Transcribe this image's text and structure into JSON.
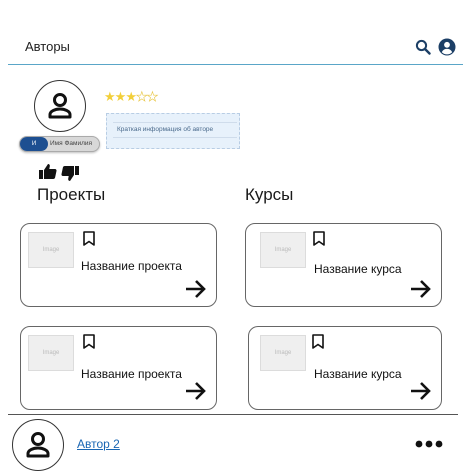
{
  "header": {
    "title": "Авторы",
    "search_icon": "search-icon",
    "account_icon": "account-circle-icon"
  },
  "author": {
    "rating": 3,
    "rating_max": 5,
    "short_info": "Краткая информация об авторе",
    "name_pill": {
      "initials": "И",
      "label": "Имя Фамилия"
    },
    "like_icon": "thumbs-up-icon",
    "dislike_icon": "thumbs-down-icon"
  },
  "projects": {
    "title": "Проекты",
    "cards": [
      {
        "image_label": "Image",
        "name": "Название проекта"
      },
      {
        "image_label": "Image",
        "name": "Название проекта"
      }
    ]
  },
  "courses": {
    "title": "Курсы",
    "cards": [
      {
        "image_label": "Image",
        "name": "Название курса"
      },
      {
        "image_label": "Image",
        "name": "Название курса"
      }
    ]
  },
  "next_author": {
    "name": "Автор 2",
    "more_icon": "more-horizontal-icon"
  },
  "colors": {
    "accent_line": "#5aa6c8",
    "link": "#1a66b3",
    "star": "#f2cf3a",
    "pill_knob": "#1d4f91"
  }
}
